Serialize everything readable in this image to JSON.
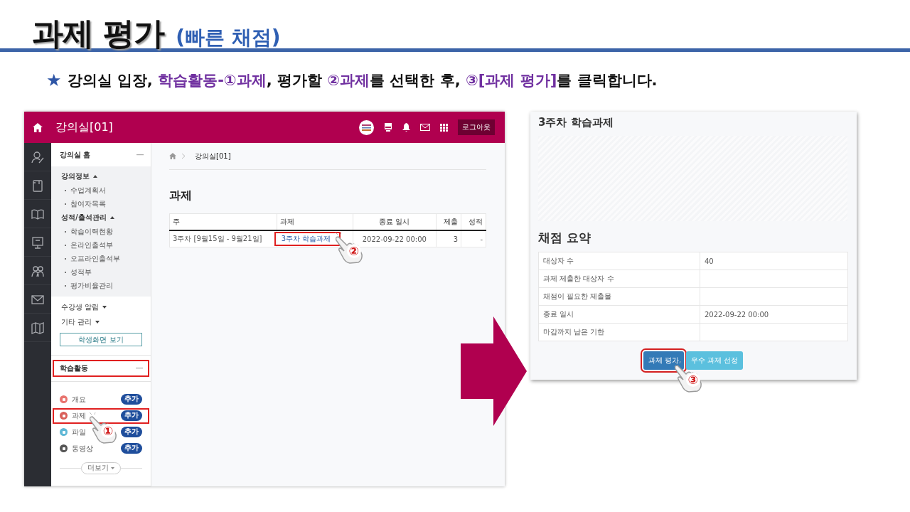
{
  "slide": {
    "title": "과제 평가",
    "subtitle": "(빠른 채점)"
  },
  "instruction": {
    "star": "★",
    "segments": [
      {
        "text": "강의실 입장, ",
        "highlight": false
      },
      {
        "text": "학습활동-①과제",
        "highlight": true
      },
      {
        "text": ", 평가할 ",
        "highlight": false
      },
      {
        "text": "②과제",
        "highlight": true
      },
      {
        "text": "를 선택한 후, ",
        "highlight": false
      },
      {
        "text": "③[과제 평가]",
        "highlight": true
      },
      {
        "text": "를 클릭합니다.",
        "highlight": false
      }
    ]
  },
  "lms": {
    "header": {
      "title": "강의실[01]",
      "logout": "로그아웃"
    },
    "sidebar": {
      "home": {
        "title": "강의실 홈"
      },
      "groups": [
        {
          "label": "강의정보",
          "expanded": true,
          "children": [
            "수업계획서",
            "참여자목록"
          ]
        },
        {
          "label": "성적/출석관리",
          "expanded": true,
          "children": [
            "학습이력현황",
            "온라인출석부",
            "오프라인출석부",
            "성적부",
            "평가비율관리"
          ]
        },
        {
          "label": "수강생 알림",
          "expanded": false
        },
        {
          "label": "기타 관리",
          "expanded": false
        }
      ],
      "student_view_button": "학생화면 보기",
      "activities": {
        "title": "학습활동",
        "highlighted": true,
        "items": [
          {
            "label": "개요",
            "color": "#e8736e",
            "badge": "추가",
            "highlighted": false
          },
          {
            "label": "과제",
            "color": "#d9605a",
            "badge": "추가",
            "highlighted": true,
            "pointer": "①"
          },
          {
            "label": "파일",
            "color": "#5fb8d6",
            "badge": "추가",
            "highlighted": false
          },
          {
            "label": "동영상",
            "color": "#555555",
            "badge": "추가",
            "highlighted": false
          }
        ],
        "more": "더보기"
      }
    },
    "main": {
      "breadcrumb": "강의실[01]",
      "heading": "과제",
      "table": {
        "columns": [
          "주",
          "과제",
          "종료 일시",
          "제출",
          "성적"
        ],
        "rows": [
          {
            "week": "3주차 [9월15일 - 9월21일]",
            "assignment": {
              "text": "3주차 학습과제",
              "highlighted": true,
              "pointer": "②"
            },
            "due": "2022-09-22 00:00",
            "submitted": "3",
            "grade": "-"
          }
        ]
      }
    }
  },
  "panel": {
    "title": "3주차 학습과제",
    "summary_title": "채점 요약",
    "summary": [
      {
        "label": "대상자 수",
        "value": "40"
      },
      {
        "label": "과제 제출한 대상자 수"
      },
      {
        "label": "채점이 필요한 제출물"
      },
      {
        "label": "종료 일시",
        "value": "2022-09-22 00:00"
      },
      {
        "label": "마감까지 남은 기한"
      }
    ],
    "buttons": [
      {
        "label": "과제 평가",
        "kind": "primary",
        "highlighted": true,
        "pointer": "③"
      },
      {
        "label": "우수 과제 선정",
        "kind": "info",
        "highlighted": false
      }
    ]
  }
}
